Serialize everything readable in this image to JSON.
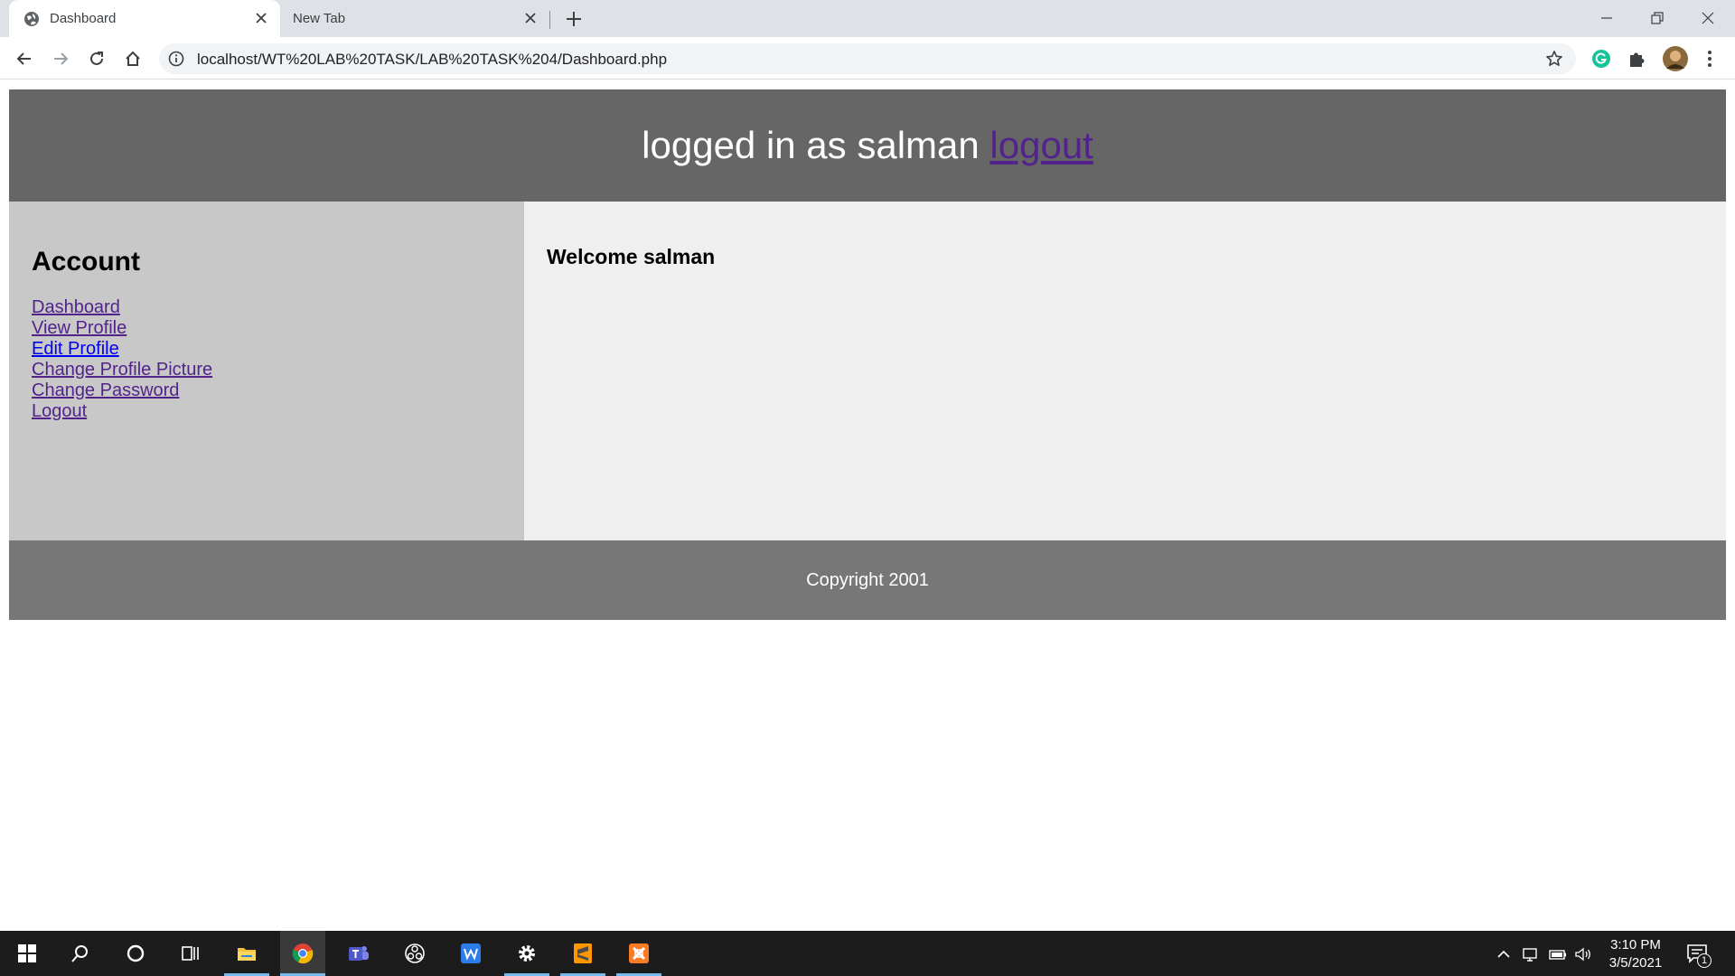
{
  "browser": {
    "tabs": [
      {
        "label": "Dashboard",
        "active": true
      },
      {
        "label": "New Tab",
        "active": false
      }
    ],
    "url": "localhost/WT%20LAB%20TASK/LAB%20TASK%204/Dashboard.php"
  },
  "page": {
    "header": {
      "text": "logged in as salman",
      "logout_link": "logout"
    },
    "sidebar": {
      "title": "Account",
      "links": [
        {
          "label": "Dashboard"
        },
        {
          "label": "View Profile"
        },
        {
          "label": "Edit Profile"
        },
        {
          "label": "Change Profile Picture"
        },
        {
          "label": "Change Password"
        },
        {
          "label": "Logout"
        }
      ]
    },
    "main": {
      "welcome": "Welcome salman"
    },
    "footer": {
      "text": "Copyright 2001"
    }
  },
  "taskbar": {
    "apps": [
      "windows-start-icon",
      "search-icon",
      "cortana-icon",
      "task-view-icon",
      "file-explorer-icon",
      "chrome-icon",
      "teams-icon",
      "obs-icon",
      "wps-writer-icon",
      "settings-icon",
      "sublime-text-icon",
      "xampp-icon"
    ],
    "time": "3:10 PM",
    "date": "3/5/2021",
    "notification_count": "1"
  },
  "colors": {
    "header_bg": "#666666",
    "sidebar_bg": "#c8c8c8",
    "main_bg": "#efefef",
    "footer_bg": "#777777",
    "visited_link": "#52248b",
    "link": "#0000ee"
  }
}
